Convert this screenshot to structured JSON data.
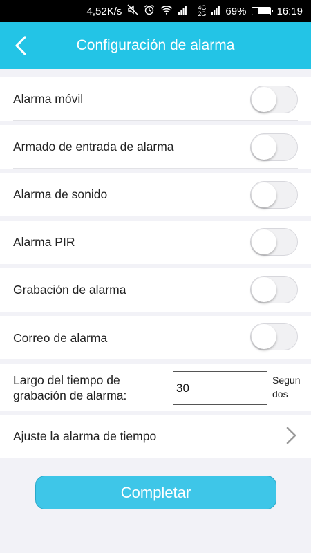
{
  "status_bar": {
    "speed": "4,52K/s",
    "network_top": "4G",
    "network_bottom": "2G",
    "battery": "69%",
    "battery_level": 0.69,
    "time": "16:19",
    "icons": [
      "mute-icon",
      "alarm-clock-icon",
      "wifi-icon",
      "signal-icon",
      "signal-icon",
      "battery-icon"
    ]
  },
  "header": {
    "title": "Configuración de alarma",
    "back_icon": "chevron-left-icon"
  },
  "settings": [
    {
      "label": "Alarma móvil",
      "enabled": false
    },
    {
      "label": "Armado de entrada de alarma",
      "enabled": false
    },
    {
      "label": "Alarma de sonido",
      "enabled": false
    },
    {
      "label": "Alarma PIR",
      "enabled": false
    },
    {
      "label": "Grabación de alarma",
      "enabled": false
    },
    {
      "label": "Correo de alarma",
      "enabled": false
    }
  ],
  "recording_duration": {
    "label_line1": "Largo del tiempo de",
    "label_line2": "grabación de alarma:",
    "value": "30",
    "unit": "Segundos"
  },
  "time_alarm": {
    "label": "Ajuste la alarma de tiempo",
    "icon": "chevron-right-icon"
  },
  "complete_button": {
    "label": "Completar"
  },
  "colors": {
    "header": "#23c4e6",
    "button": "#3ec6e8",
    "background": "#f2f2f7"
  }
}
